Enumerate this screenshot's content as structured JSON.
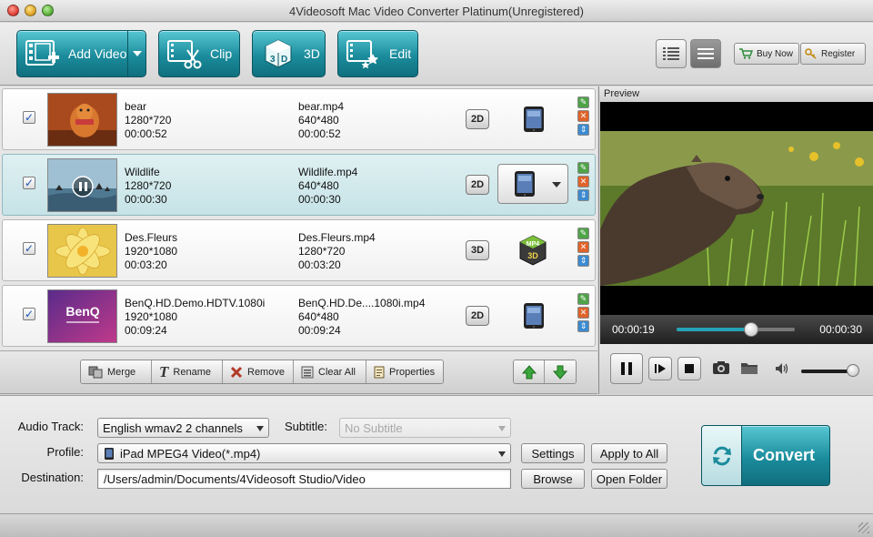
{
  "window": {
    "title": "4Videosoft Mac Video Converter Platinum(Unregistered)"
  },
  "toolbar": {
    "add_video": "Add Video",
    "clip": "Clip",
    "three_d": "3D",
    "edit": "Edit",
    "buy_now": "Buy Now",
    "register": "Register"
  },
  "files": [
    {
      "name": "bear",
      "resolution": "1280*720",
      "duration": "00:00:52",
      "out_name": "bear.mp4",
      "out_resolution": "640*480",
      "out_duration": "00:00:52",
      "mode": "2D",
      "checked": "✓"
    },
    {
      "name": "Wildlife",
      "resolution": "1280*720",
      "duration": "00:00:30",
      "out_name": "Wildlife.mp4",
      "out_resolution": "640*480",
      "out_duration": "00:00:30",
      "mode": "2D",
      "checked": "✓"
    },
    {
      "name": "Des.Fleurs",
      "resolution": "1920*1080",
      "duration": "00:03:20",
      "out_name": "Des.Fleurs.mp4",
      "out_resolution": "1280*720",
      "out_duration": "00:03:20",
      "mode": "3D",
      "checked": "✓"
    },
    {
      "name": "BenQ.HD.Demo.HDTV.1080i",
      "resolution": "1920*1080",
      "duration": "00:09:24",
      "out_name": "BenQ.HD.De....1080i.mp4",
      "out_resolution": "640*480",
      "out_duration": "00:09:24",
      "mode": "2D",
      "checked": "✓",
      "thumb_text": "BenQ"
    }
  ],
  "mp4_3d_icon": {
    "top": "MP4",
    "bottom": "3D"
  },
  "listbar": {
    "merge": "Merge",
    "rename": "Rename",
    "remove": "Remove",
    "clear_all": "Clear All",
    "properties": "Properties"
  },
  "preview": {
    "header": "Preview",
    "current_time": "00:00:19",
    "total_time": "00:00:30",
    "progress": 0.63,
    "volume": 0.92
  },
  "settings": {
    "audio_track_label": "Audio Track:",
    "audio_track_value": "English wmav2 2 channels",
    "subtitle_label": "Subtitle:",
    "subtitle_value": "No Subtitle",
    "profile_label": "Profile:",
    "profile_value": "iPad MPEG4 Video(*.mp4)",
    "destination_label": "Destination:",
    "destination_value": "/Users/admin/Documents/4Videosoft Studio/Video",
    "settings_btn": "Settings",
    "apply_all_btn": "Apply to All",
    "browse_btn": "Browse",
    "open_folder_btn": "Open Folder",
    "convert_btn": "Convert"
  },
  "colors": {
    "accent": "#1b8c9c",
    "accent_light": "#58c7d3",
    "selected_row": "#c6e3e7"
  }
}
